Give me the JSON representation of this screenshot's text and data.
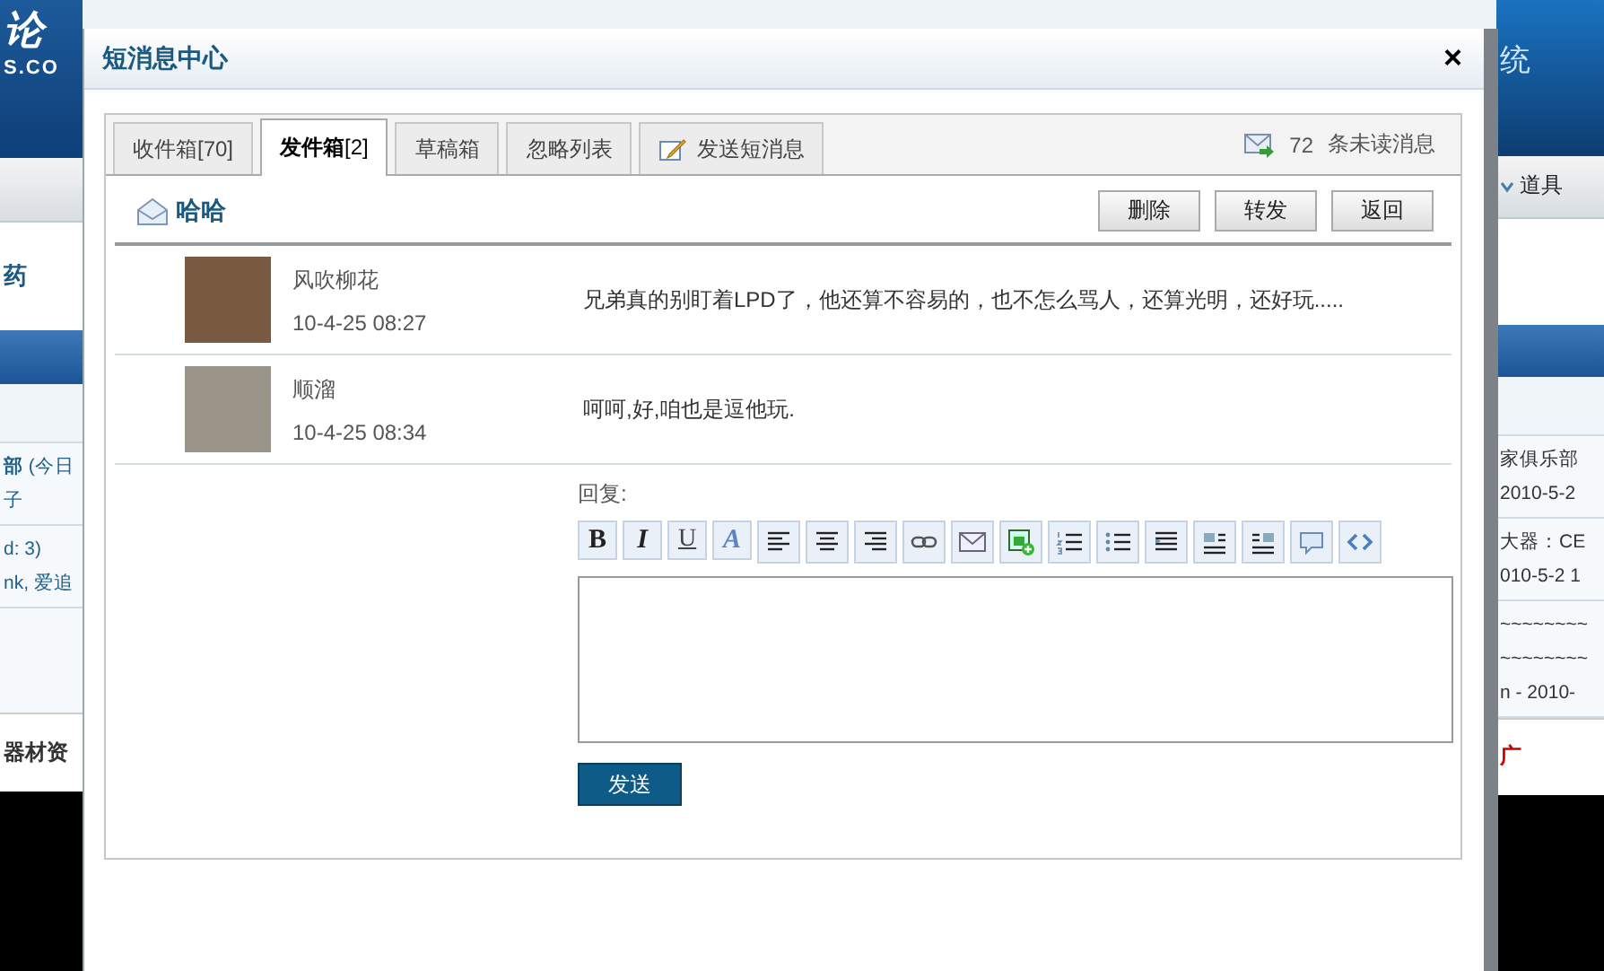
{
  "background_page": {
    "left": {
      "banner": [
        "论",
        "S.CO"
      ],
      "heading": "药",
      "rows": [
        [
          "**部** (今日",
          "子"
        ],
        [
          "d: 3)",
          "nk, 爱追"
        ]
      ],
      "footer": "器材资"
    },
    "right": {
      "banner": [
        "统"
      ],
      "nav": "道具",
      "rows": [
        [
          "家俱乐部",
          "2010-5-2"
        ],
        [
          "大器：CE",
          "010-5-2 1"
        ],
        [
          "~~~~~~~~",
          "~~~~~~~~",
          "n - 2010-"
        ]
      ],
      "footer": "广"
    }
  },
  "dialog": {
    "title": "短消息中心",
    "close": "×",
    "tabs": [
      {
        "label": "收件箱[70]",
        "kind": "folder",
        "selected": false
      },
      {
        "label": "**发件箱**[2]",
        "kind": "folder",
        "selected": true
      },
      {
        "label": "草稿箱",
        "kind": "folder",
        "selected": false
      },
      {
        "label": "忽略列表",
        "kind": "folder",
        "selected": false
      },
      {
        "label": "发送短消息",
        "kind": "compose",
        "selected": false
      }
    ],
    "unread": {
      "count": "72",
      "label": "条未读消息"
    },
    "subject": "哈哈",
    "actions": [
      "删除",
      "转发",
      "返回"
    ],
    "messages": [
      {
        "name": "风吹柳花",
        "time": "10-4-25 08:27",
        "text": "兄弟真的别盯着LPD了，他还算不容易的，也不怎么骂人，还算光明，还好玩....."
      },
      {
        "name": "顺溜",
        "time": "10-4-25 08:34",
        "text": "呵呵,好,咱也是逗他玩."
      }
    ],
    "reply": {
      "label": "回复:",
      "toolbar": [
        {
          "kind": "bold",
          "label": "B"
        },
        {
          "kind": "italic",
          "label": "I"
        },
        {
          "kind": "underline",
          "label": "U"
        },
        {
          "kind": "fontcolor",
          "label": "A"
        },
        {
          "kind": "alignleft"
        },
        {
          "kind": "aligncenter"
        },
        {
          "kind": "alignright"
        },
        {
          "kind": "link"
        },
        {
          "kind": "email"
        },
        {
          "kind": "image"
        },
        {
          "kind": "orderedlist"
        },
        {
          "kind": "bulletlist"
        },
        {
          "kind": "indent"
        },
        {
          "kind": "floatleft"
        },
        {
          "kind": "floatright"
        },
        {
          "kind": "quote"
        },
        {
          "kind": "code"
        }
      ],
      "send": "发送"
    }
  }
}
